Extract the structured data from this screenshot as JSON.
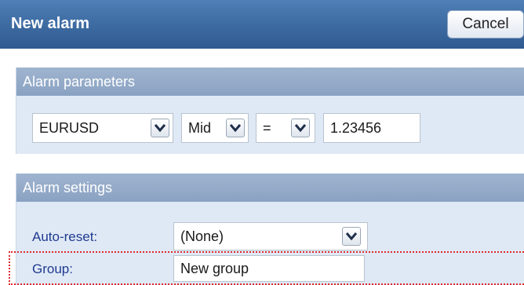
{
  "window": {
    "title": "New alarm",
    "cancel_label": "Cancel"
  },
  "alarm_parameters": {
    "header": "Alarm parameters",
    "symbol": "EURUSD",
    "price_type": "Mid",
    "operator": "=",
    "value": "1.23456"
  },
  "alarm_settings": {
    "header": "Alarm settings",
    "auto_reset_label": "Auto-reset:",
    "auto_reset_value": "(None)",
    "group_label": "Group:",
    "group_value": "New group"
  },
  "colors": {
    "titlebar": "#3c6aa0",
    "panel_header": "#8aa2c2",
    "panel_bg": "#dfe9f6",
    "label_text": "#203a8f",
    "highlight_border": "#e0292b"
  }
}
